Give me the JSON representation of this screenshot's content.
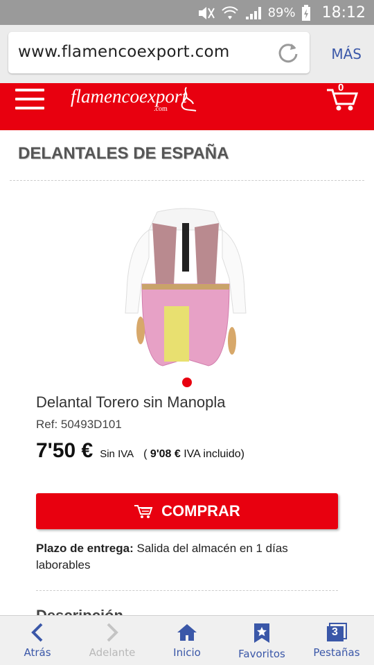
{
  "status_bar": {
    "battery_percent": "89%",
    "time": "18:12"
  },
  "browser": {
    "url": "www.flamencoexport.com",
    "menu_label": "MÁS"
  },
  "site_header": {
    "logo_text": "flamencoexport",
    "logo_suffix": ".com",
    "cart_count": "0"
  },
  "page": {
    "title": "DELANTALES DE ESPAÑA",
    "product": {
      "name": "Delantal Torero sin Manopla",
      "ref": "Ref: 50493D101",
      "price": "7'50 €",
      "price_note": "Sin IVA",
      "price_incl_value": "9'08 €",
      "price_incl_label": "IVA incluido",
      "buy_label": "COMPRAR",
      "delivery_label": "Plazo de entrega:",
      "delivery_text": "Salida del almacén en 1 días laborables"
    },
    "description_heading": "Descripción"
  },
  "bottom_nav": {
    "items": [
      {
        "label": "Atrás",
        "icon": "chevron-left-icon",
        "enabled": true
      },
      {
        "label": "Adelante",
        "icon": "chevron-right-icon",
        "enabled": false
      },
      {
        "label": "Inicio",
        "icon": "home-icon",
        "enabled": true
      },
      {
        "label": "Favoritos",
        "icon": "bookmark-star-icon",
        "enabled": true
      },
      {
        "label": "Pestañas",
        "icon": "tabs-icon",
        "enabled": true,
        "count": "3"
      }
    ]
  },
  "colors": {
    "brand_red": "#e8000f",
    "nav_blue": "#3a57a8"
  }
}
